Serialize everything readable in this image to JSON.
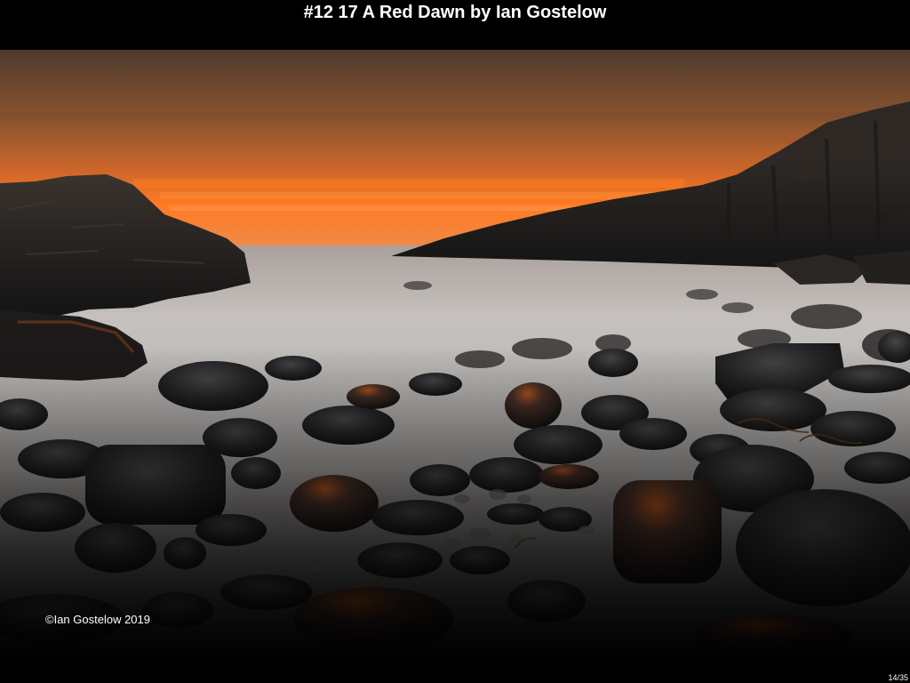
{
  "slide": {
    "title": "#12 17 A Red Dawn by Ian Gostelow",
    "watermark": "©Ian Gostelow 2019",
    "counter": "14/35"
  },
  "photo": {
    "subject": "long-exposure seascape of a rocky cove at sunrise",
    "palette": {
      "sky_top": "#5e4230",
      "sky_mid": "#b8622a",
      "horizon_glow": "#ff6a1a",
      "sea_mist": "#c9c6c2",
      "rocks": "#1c1c1e",
      "rock_highlight": "#c2541f"
    }
  }
}
